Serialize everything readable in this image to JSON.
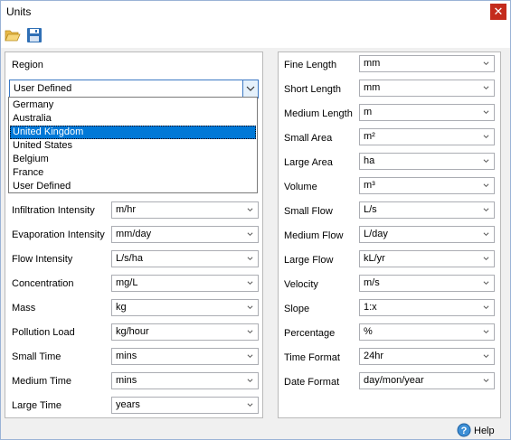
{
  "window": {
    "title": "Units",
    "close_glyph": "✕"
  },
  "toolbar": {
    "open_icon": "folder-open-icon",
    "save_icon": "floppy-disk-icon"
  },
  "region": {
    "label": "Region",
    "selected": "User Defined",
    "highlighted": "United Kingdom",
    "options": [
      "Germany",
      "Australia",
      "United Kingdom",
      "United States",
      "Belgium",
      "France",
      "User Defined"
    ]
  },
  "left_fields": [
    {
      "label": "Infiltration Intensity",
      "value": "m/hr"
    },
    {
      "label": "Evaporation Intensity",
      "value": "mm/day"
    },
    {
      "label": "Flow Intensity",
      "value": "L/s/ha"
    },
    {
      "label": "Concentration",
      "value": "mg/L"
    },
    {
      "label": "Mass",
      "value": "kg"
    },
    {
      "label": "Pollution Load",
      "value": "kg/hour"
    },
    {
      "label": "Small Time",
      "value": "mins"
    },
    {
      "label": "Medium Time",
      "value": "mins"
    },
    {
      "label": "Large Time",
      "value": "years"
    }
  ],
  "right_fields": [
    {
      "label": "Fine Length",
      "value": "mm"
    },
    {
      "label": "Short Length",
      "value": "mm"
    },
    {
      "label": "Medium Length",
      "value": "m"
    },
    {
      "label": "Small Area",
      "value": "m²"
    },
    {
      "label": "Large Area",
      "value": "ha"
    },
    {
      "label": "Volume",
      "value": "m³"
    },
    {
      "label": "Small Flow",
      "value": "L/s"
    },
    {
      "label": "Medium Flow",
      "value": "L/day"
    },
    {
      "label": "Large Flow",
      "value": "kL/yr"
    },
    {
      "label": "Velocity",
      "value": "m/s"
    },
    {
      "label": "Slope",
      "value": "1:x"
    },
    {
      "label": "Percentage",
      "value": "%"
    },
    {
      "label": "Time Format",
      "value": "24hr"
    },
    {
      "label": "Date Format",
      "value": "day/mon/year"
    }
  ],
  "footer": {
    "help_label": "Help",
    "help_icon": "help-icon"
  },
  "colors": {
    "highlight": "#0078d7",
    "close": "#c42b1c",
    "accent_border": "#3b78c4"
  }
}
